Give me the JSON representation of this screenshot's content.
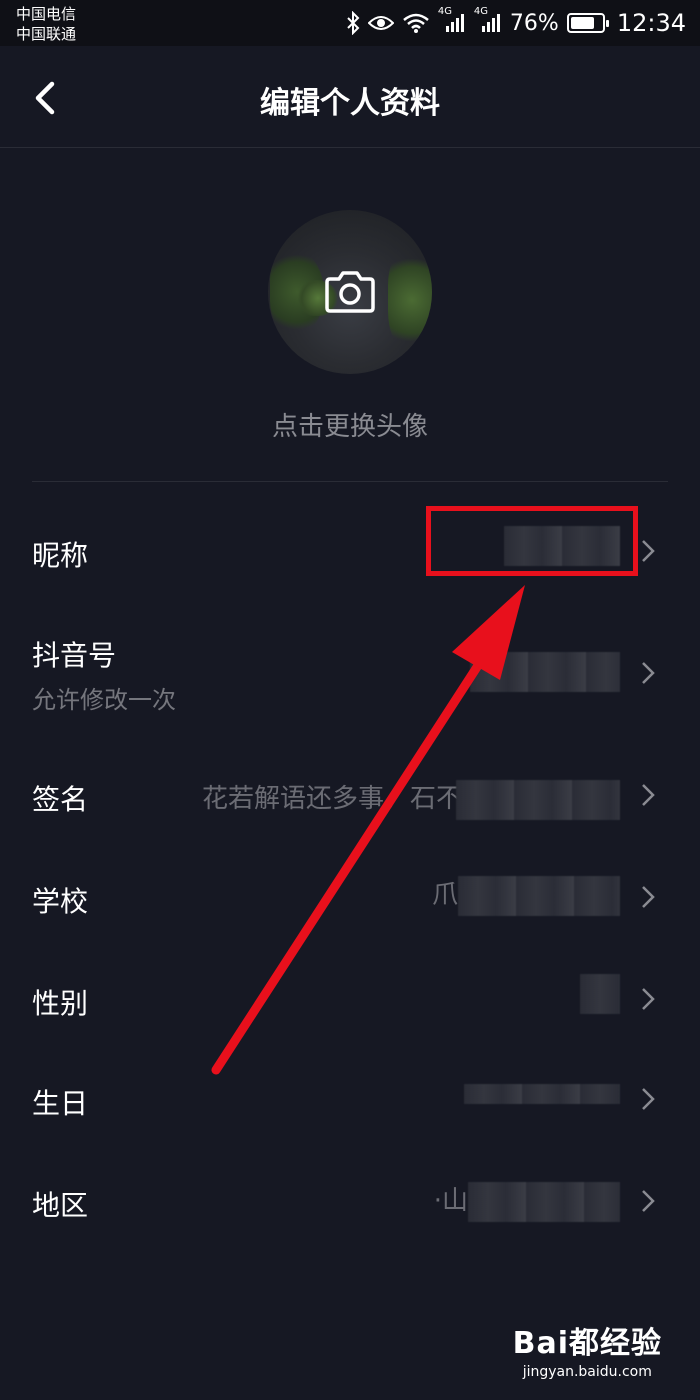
{
  "statusbar": {
    "carrier1": "中国电信",
    "carrier2": "中国联通",
    "signal1_label": "4G",
    "signal2_label": "4G",
    "battery_pct": "76%",
    "battery_level": 0.76,
    "time": "12:34"
  },
  "header": {
    "title": "编辑个人资料"
  },
  "avatar": {
    "hint": "点击更换头像"
  },
  "rows": [
    {
      "label": "昵称",
      "sub": "",
      "value": ""
    },
    {
      "label": "抖音号",
      "sub": "允许修改一次",
      "value": ""
    },
    {
      "label": "签名",
      "sub": "",
      "value": "花若解语还多事，石不"
    },
    {
      "label": "学校",
      "sub": "",
      "value": "爪"
    },
    {
      "label": "性别",
      "sub": "",
      "value": ""
    },
    {
      "label": "生日",
      "sub": "",
      "value": ""
    },
    {
      "label": "地区",
      "sub": "",
      "value": "·山"
    }
  ],
  "watermark": {
    "brand": "Bai都经验",
    "url": "jingyan.baidu.com"
  },
  "colors": {
    "background": "#161823",
    "annotation_red": "#e8101c"
  },
  "icons": [
    "back-arrow-icon",
    "camera-icon",
    "chevron-right-icon",
    "bluetooth-icon",
    "eye-icon",
    "wifi-icon",
    "signal-icon",
    "battery-icon"
  ]
}
